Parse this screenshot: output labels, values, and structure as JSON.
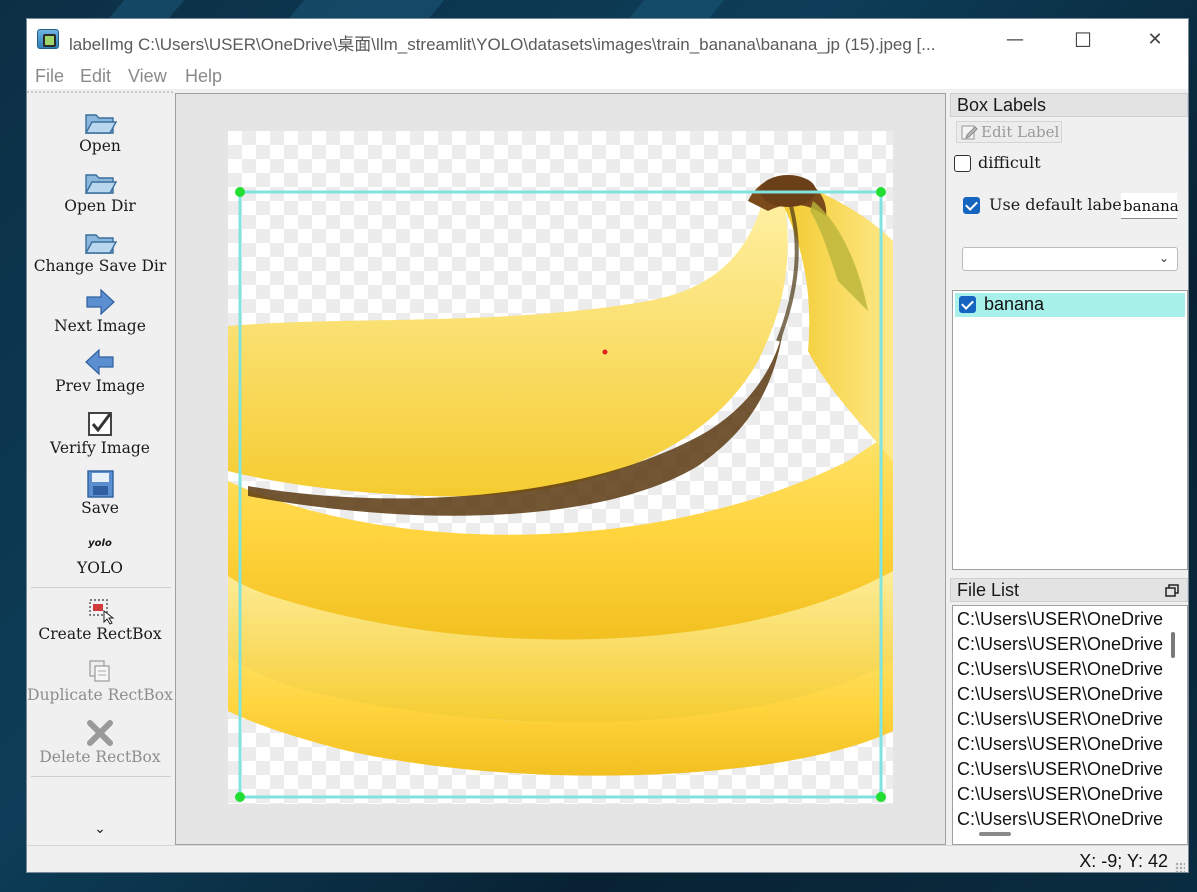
{
  "window": {
    "title": "labelImg C:\\Users\\USER\\OneDrive\\桌面\\llm_streamlit\\YOLO\\datasets\\images\\train_banana\\banana_jp (15).jpeg [...",
    "minimize_glyph": "—",
    "maximize_glyph": "☐",
    "close_glyph": "✕"
  },
  "menu": [
    "File",
    "Edit",
    "View",
    "Help"
  ],
  "toolbar": {
    "open": "Open",
    "open_dir": "Open Dir",
    "change_save_dir": "Change Save Dir",
    "next_image": "Next Image",
    "prev_image": "Prev Image",
    "verify_image": "Verify Image",
    "save": "Save",
    "yolo_badge": "yolo",
    "yolo": "YOLO",
    "create_rectbox": "Create RectBox",
    "duplicate_rectbox": "Duplicate RectBox",
    "delete_rectbox": "Delete RectBox",
    "more_glyph": "⌄"
  },
  "box_labels": {
    "title": "Box Labels",
    "edit_label": "Edit Label",
    "difficult": "difficult",
    "difficult_checked": false,
    "use_default_label": "Use default label",
    "use_default_label_checked": true,
    "default_label_value": "banana",
    "combo_value": "",
    "labels": [
      {
        "name": "banana",
        "checked": true
      }
    ]
  },
  "file_list": {
    "title": "File List",
    "items": [
      "C:\\Users\\USER\\OneDrive",
      "C:\\Users\\USER\\OneDrive",
      "C:\\Users\\USER\\OneDrive",
      "C:\\Users\\USER\\OneDrive",
      "C:\\Users\\USER\\OneDrive",
      "C:\\Users\\USER\\OneDrive",
      "C:\\Users\\USER\\OneDrive",
      "C:\\Users\\USER\\OneDrive",
      "C:\\Users\\USER\\OneDrive"
    ]
  },
  "status": {
    "coords": "X: -9; Y: 42"
  },
  "colors": {
    "box_outline": "#7fe3e0",
    "box_handle": "#22dd33",
    "label_highlight": "#a8f0ea",
    "checkbox_checked": "#1565c0"
  }
}
